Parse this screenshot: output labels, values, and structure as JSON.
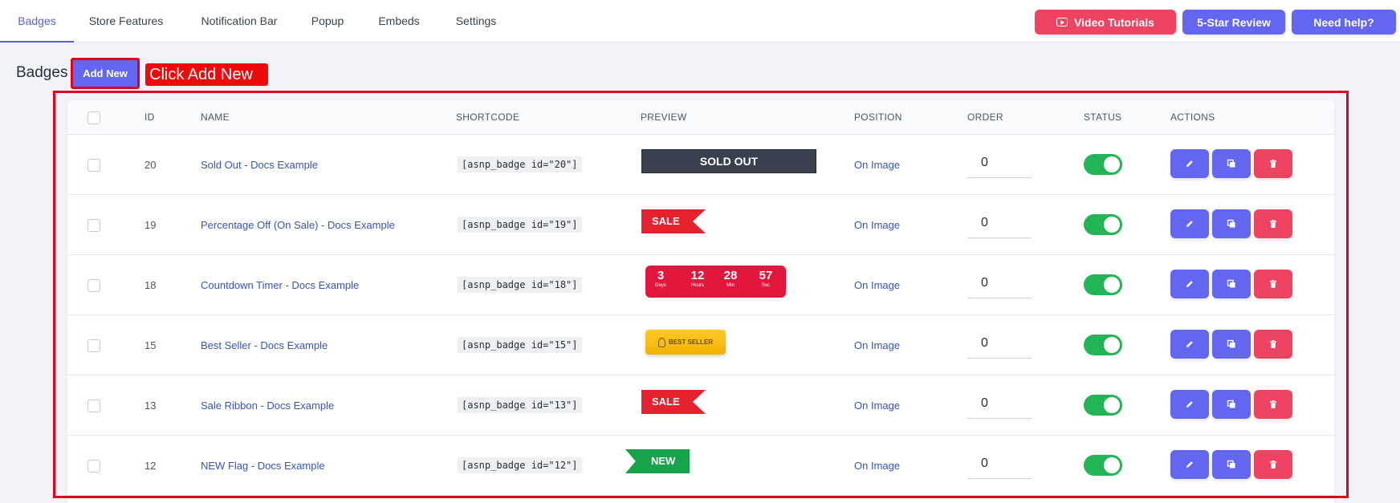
{
  "nav": {
    "tabs": [
      "Badges",
      "Store Features",
      "Notification Bar",
      "Popup",
      "Embeds",
      "Settings"
    ],
    "active_tab": "Badges",
    "buttons": {
      "video": "Video Tutorials",
      "review": "5-Star Review",
      "help": "Need help?"
    }
  },
  "header": {
    "title": "Badges",
    "add_new": "Add New",
    "callout": "Click Add New"
  },
  "table": {
    "columns": [
      "ID",
      "NAME",
      "SHORTCODE",
      "PREVIEW",
      "POSITION",
      "ORDER",
      "STATUS",
      "ACTIONS"
    ],
    "rows": [
      {
        "id": "20",
        "name": "Sold Out - Docs Example",
        "shortcode": "[asnp_badge id=\"20\"]",
        "position": "On Image",
        "order": "0",
        "status": "on",
        "preview": {
          "type": "sold-out",
          "text": "SOLD OUT"
        }
      },
      {
        "id": "19",
        "name": "Percentage Off (On Sale) - Docs Example",
        "shortcode": "[asnp_badge id=\"19\"]",
        "position": "On Image",
        "order": "0",
        "status": "on",
        "preview": {
          "type": "sale",
          "text": "SALE"
        }
      },
      {
        "id": "18",
        "name": "Countdown Timer - Docs Example",
        "shortcode": "[asnp_badge id=\"18\"]",
        "position": "On Image",
        "order": "0",
        "status": "on",
        "preview": {
          "type": "timer",
          "days": "3",
          "hours": "12",
          "min": "28",
          "sec": "57",
          "days_label": "Days",
          "hours_label": "Hours",
          "min_label": "Min",
          "sec_label": "Sec"
        }
      },
      {
        "id": "15",
        "name": "Best Seller - Docs Example",
        "shortcode": "[asnp_badge id=\"15\"]",
        "position": "On Image",
        "order": "0",
        "status": "on",
        "preview": {
          "type": "best-seller",
          "text": "BEST SELLER"
        }
      },
      {
        "id": "13",
        "name": "Sale Ribbon - Docs Example",
        "shortcode": "[asnp_badge id=\"13\"]",
        "position": "On Image",
        "order": "0",
        "status": "on",
        "preview": {
          "type": "sale",
          "text": "SALE"
        }
      },
      {
        "id": "12",
        "name": "NEW Flag - Docs Example",
        "shortcode": "[asnp_badge id=\"12\"]",
        "position": "On Image",
        "order": "0",
        "status": "on",
        "preview": {
          "type": "new",
          "text": "NEW"
        }
      }
    ]
  },
  "colors": {
    "accent": "#6366f1",
    "danger": "#ef4461",
    "success": "#22b455",
    "highlight": "#e0001b"
  }
}
